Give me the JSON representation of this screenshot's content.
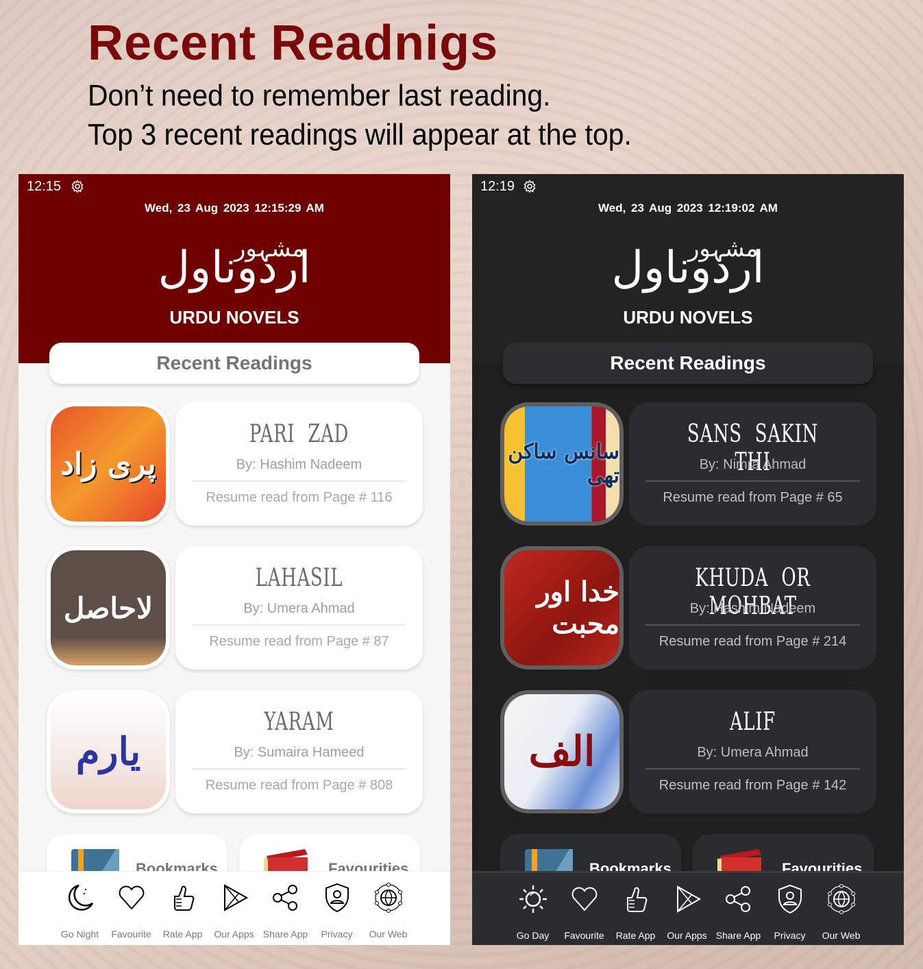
{
  "promo": {
    "title": "Recent Readnigs",
    "line1": "Don’t need to remember last reading.",
    "line2": "Top 3 recent readings will appear at the top."
  },
  "colors": {
    "light_header": "#6e0000",
    "dark_header": "#232323",
    "promo_title": "#7a0a0a"
  },
  "light": {
    "status_time": "12:15",
    "datetime": "Wed, 23  Aug  2023   12:15:29 AM",
    "logo_urdu_small": "مشہور",
    "logo_urdu_big": "اردوناول",
    "logo_en": "URDU NOVELS",
    "section_title": "Recent Readings",
    "readings": [
      {
        "cover_text": "پری زاد",
        "title": "PARI  ZAD",
        "author": "By: Hashim Nadeem",
        "resume": "Resume read from Page # 116"
      },
      {
        "cover_text": "لاحاصل",
        "title": "LAHASIL",
        "author": "By: Umera Ahmad",
        "resume": "Resume read from Page # 87"
      },
      {
        "cover_text": "یارم",
        "title": "YARAM",
        "author": "By: Sumaira Hameed",
        "resume": "Resume read from Page # 808"
      }
    ],
    "tiles": [
      {
        "label": "Bookmarks"
      },
      {
        "label": "Favourities"
      }
    ],
    "nav": [
      {
        "icon": "moon-icon",
        "label": "Go Night"
      },
      {
        "icon": "heart-icon",
        "label": "Favourite"
      },
      {
        "icon": "thumbs-up-icon",
        "label": "Rate App"
      },
      {
        "icon": "play-store-icon",
        "label": "Our Apps"
      },
      {
        "icon": "share-icon",
        "label": "Share App"
      },
      {
        "icon": "privacy-shield-icon",
        "label": "Privacy"
      },
      {
        "icon": "globe-icon",
        "label": "Our Web"
      }
    ]
  },
  "dark": {
    "status_time": "12:19",
    "datetime": "Wed, 23  Aug  2023   12:19:02 AM",
    "logo_urdu_small": "مشہور",
    "logo_urdu_big": "اردوناول",
    "logo_en": "URDU NOVELS",
    "section_title": "Recent Readings",
    "readings": [
      {
        "cover_text": "سانس ساکن تھی",
        "title": "SANS  SAKIN  THI",
        "author": "By: Nimra Ahmad",
        "resume": "Resume read from Page # 65"
      },
      {
        "cover_text": "خدا اور محبت",
        "title": "KHUDA  OR  MOHBAT",
        "author": "By: Hashim Nadeem",
        "resume": "Resume read from Page # 214"
      },
      {
        "cover_text": "الف",
        "title": "ALIF",
        "author": "By: Umera Ahmad",
        "resume": "Resume read from Page # 142"
      }
    ],
    "tiles": [
      {
        "label": "Bookmarks"
      },
      {
        "label": "Favourities"
      }
    ],
    "nav": [
      {
        "icon": "sun-icon",
        "label": "Go Day"
      },
      {
        "icon": "heart-icon",
        "label": "Favourite"
      },
      {
        "icon": "thumbs-up-icon",
        "label": "Rate App"
      },
      {
        "icon": "play-store-icon",
        "label": "Our Apps"
      },
      {
        "icon": "share-icon",
        "label": "Share App"
      },
      {
        "icon": "privacy-shield-icon",
        "label": "Privacy"
      },
      {
        "icon": "globe-icon",
        "label": "Our Web"
      }
    ]
  }
}
